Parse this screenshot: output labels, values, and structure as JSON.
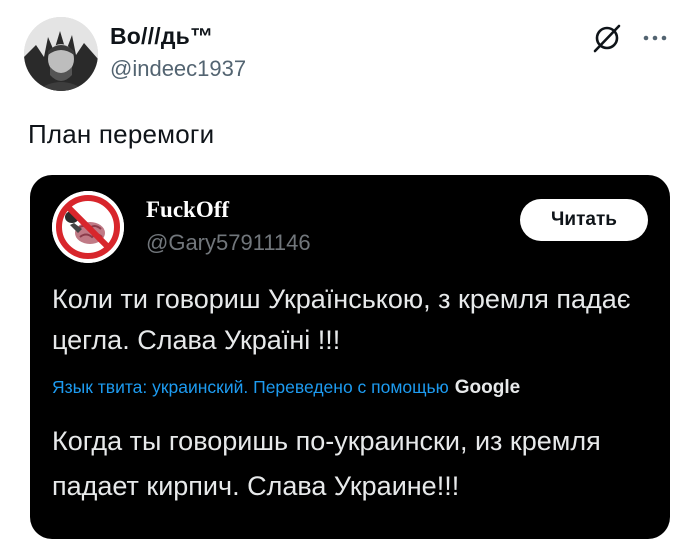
{
  "post": {
    "display_name": "Во///дь™",
    "handle": "@indeec1937",
    "text": "План перемоги",
    "icons": {
      "avatar": "avatar-portrait",
      "grok": "grok-icon",
      "more": "more-icon"
    }
  },
  "embed": {
    "display_name": "FuckOff",
    "handle": "@Gary57911146",
    "read_button": "Читать",
    "original_text": "Коли ти говориш Українською, з кремля падає цегла. Слава Україні !!!",
    "translation_label": "Язык твита: украинский. Переведено с помощью",
    "translation_provider": "Google",
    "translated_text": "Когда ты говоришь по-украински, из кремля падает кирпич. Слава Украине!!!",
    "icons": {
      "avatar": "prohibited-sign-avatar"
    }
  },
  "colors": {
    "background": "#ffffff",
    "embed_background": "#000000",
    "link_blue": "#1d9bf0",
    "muted_gray": "#536471",
    "prohibited_red": "#d8262c"
  }
}
